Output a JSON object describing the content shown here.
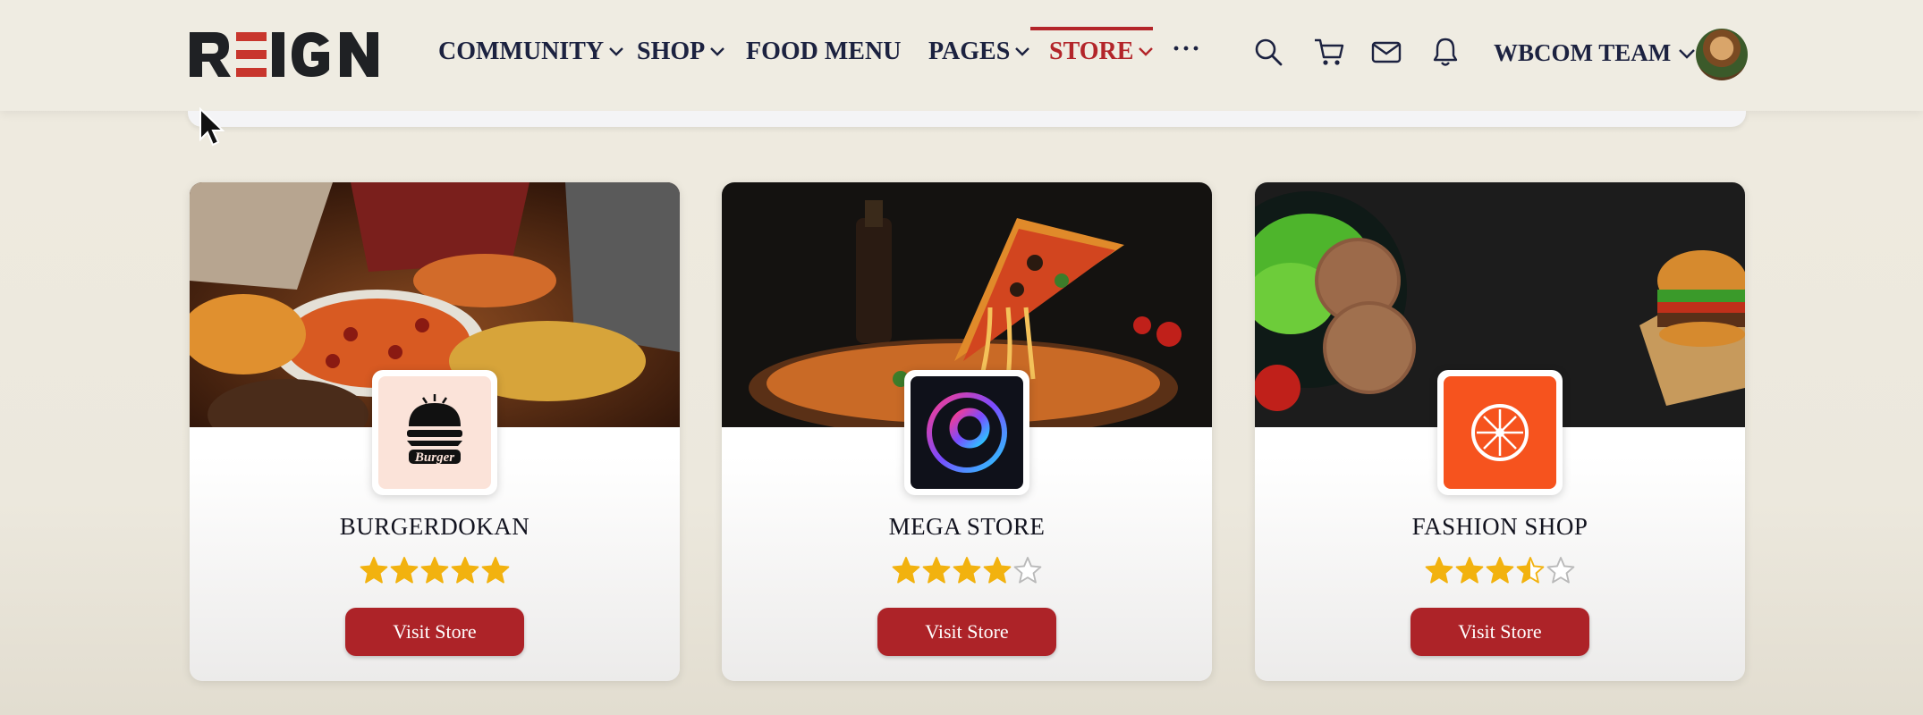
{
  "brand": {
    "logo_text": "REIGN",
    "accent": "#b3252a"
  },
  "nav": {
    "items": [
      {
        "label": "COMMUNITY",
        "has_dropdown": true
      },
      {
        "label": "SHOP",
        "has_dropdown": true
      },
      {
        "label": "FOOD MENU",
        "has_dropdown": false
      },
      {
        "label": "PAGES",
        "has_dropdown": true
      },
      {
        "label": "STORE",
        "has_dropdown": true,
        "active": true
      }
    ],
    "more_label": "···"
  },
  "header_icons": [
    "search-icon",
    "cart-icon",
    "mail-icon",
    "bell-icon"
  ],
  "user": {
    "name": "WBCOM TEAM"
  },
  "stores": [
    {
      "name": "BURGERDOKAN",
      "rating": 5,
      "button": "Visit Store",
      "logo_text": "Burger"
    },
    {
      "name": "MEGA STORE",
      "rating": 4,
      "button": "Visit Store"
    },
    {
      "name": "FASHION SHOP",
      "rating": 3.5,
      "button": "Visit Store"
    }
  ],
  "colors": {
    "star": "#f2b20f",
    "star_empty": "#b9b9b9",
    "button": "#ad2328"
  }
}
